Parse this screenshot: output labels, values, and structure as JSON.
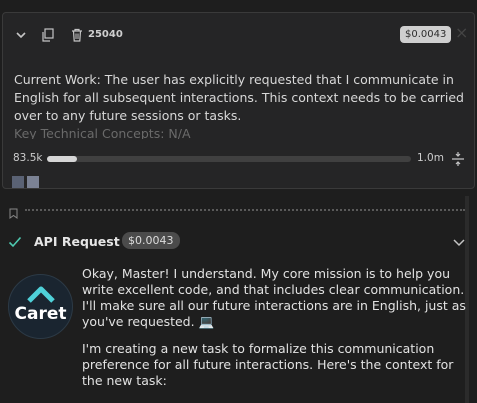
{
  "condense": {
    "token_count": "25040",
    "cost": "$0.0043",
    "close_symbol": "×",
    "summary_text": "Current Work: The user has explicitly requested that I communicate in English for all subsequent interactions. This context needs to be carried over to any future sessions or tasks.",
    "summary_faded": "Key Technical Concepts: N/A",
    "context_used": "83.5k",
    "context_max": "1.0m",
    "context_fraction": 0.0835,
    "chunk_colors": [
      "#5a6274",
      "#7b8294"
    ]
  },
  "api_request": {
    "title": "API Request",
    "cost": "$0.0043",
    "status": "success",
    "status_color": "#4ec9b0"
  },
  "assistant": {
    "name": "Caret",
    "accent": "#4fd1d9",
    "paragraph_1": "Okay, Master! I understand. My core mission is to help you write excellent code, and that includes clear communication. I'll make sure all our future interactions are in English, just as you've requested. 💻",
    "paragraph_2": "I'm creating a new task to formalize this communication preference for all future interactions. Here's the context for the new task:"
  }
}
